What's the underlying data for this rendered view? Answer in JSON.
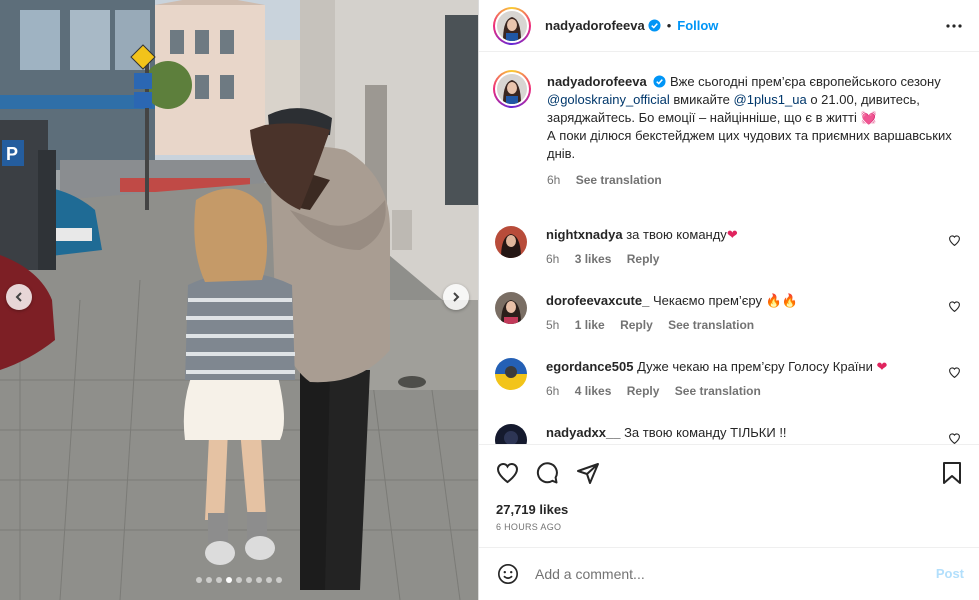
{
  "post": {
    "username": "nadyadorofeeva",
    "follow_label": "Follow",
    "separator": "•",
    "caption": {
      "part1": "Вже сьогодні прем’єра європейського сезону",
      "mention1": "@goloskrainy_official",
      "part2": "вмикайте",
      "mention2": "@1plus1_ua",
      "part3": "о 21.00, дивитесь, заряджайтесь. Бо емоції – найцінніше, що є в житті",
      "emoji": "💓",
      "part4": "А поки ділюся бекстейджем цих чудових та приємних варшавських днів.",
      "time": "6h",
      "see_translation": "See translation"
    },
    "comments": [
      {
        "username": "nightxnadya",
        "text": "за твою команду",
        "emoji": "❤",
        "time": "6h",
        "likes": "3 likes",
        "reply": "Reply",
        "translate": ""
      },
      {
        "username": "dorofeevaxcute_",
        "text": "Чекаємо прем’єру",
        "emoji": "🔥🔥",
        "time": "5h",
        "likes": "1 like",
        "reply": "Reply",
        "translate": "See translation"
      },
      {
        "username": "egordance505",
        "text": "Дуже чекаю на прем’єру Голосу Країни",
        "emoji": "❤",
        "time": "6h",
        "likes": "4 likes",
        "reply": "Reply",
        "translate": "See translation"
      },
      {
        "username": "nadyadxx__",
        "text": "За твою команду ТІЛЬКИ !!",
        "emoji": "",
        "time": "",
        "likes": "",
        "reply": "",
        "translate": ""
      }
    ],
    "likes": "27,719 likes",
    "posted": "6 HOURS AGO",
    "comment_placeholder": "Add a comment...",
    "post_label": "Post"
  },
  "carousel": {
    "slides": 9,
    "active": 4
  },
  "colors": {
    "accent": "#0095f6",
    "link": "#00376b",
    "muted": "#737373",
    "heart": "#e0245e"
  }
}
